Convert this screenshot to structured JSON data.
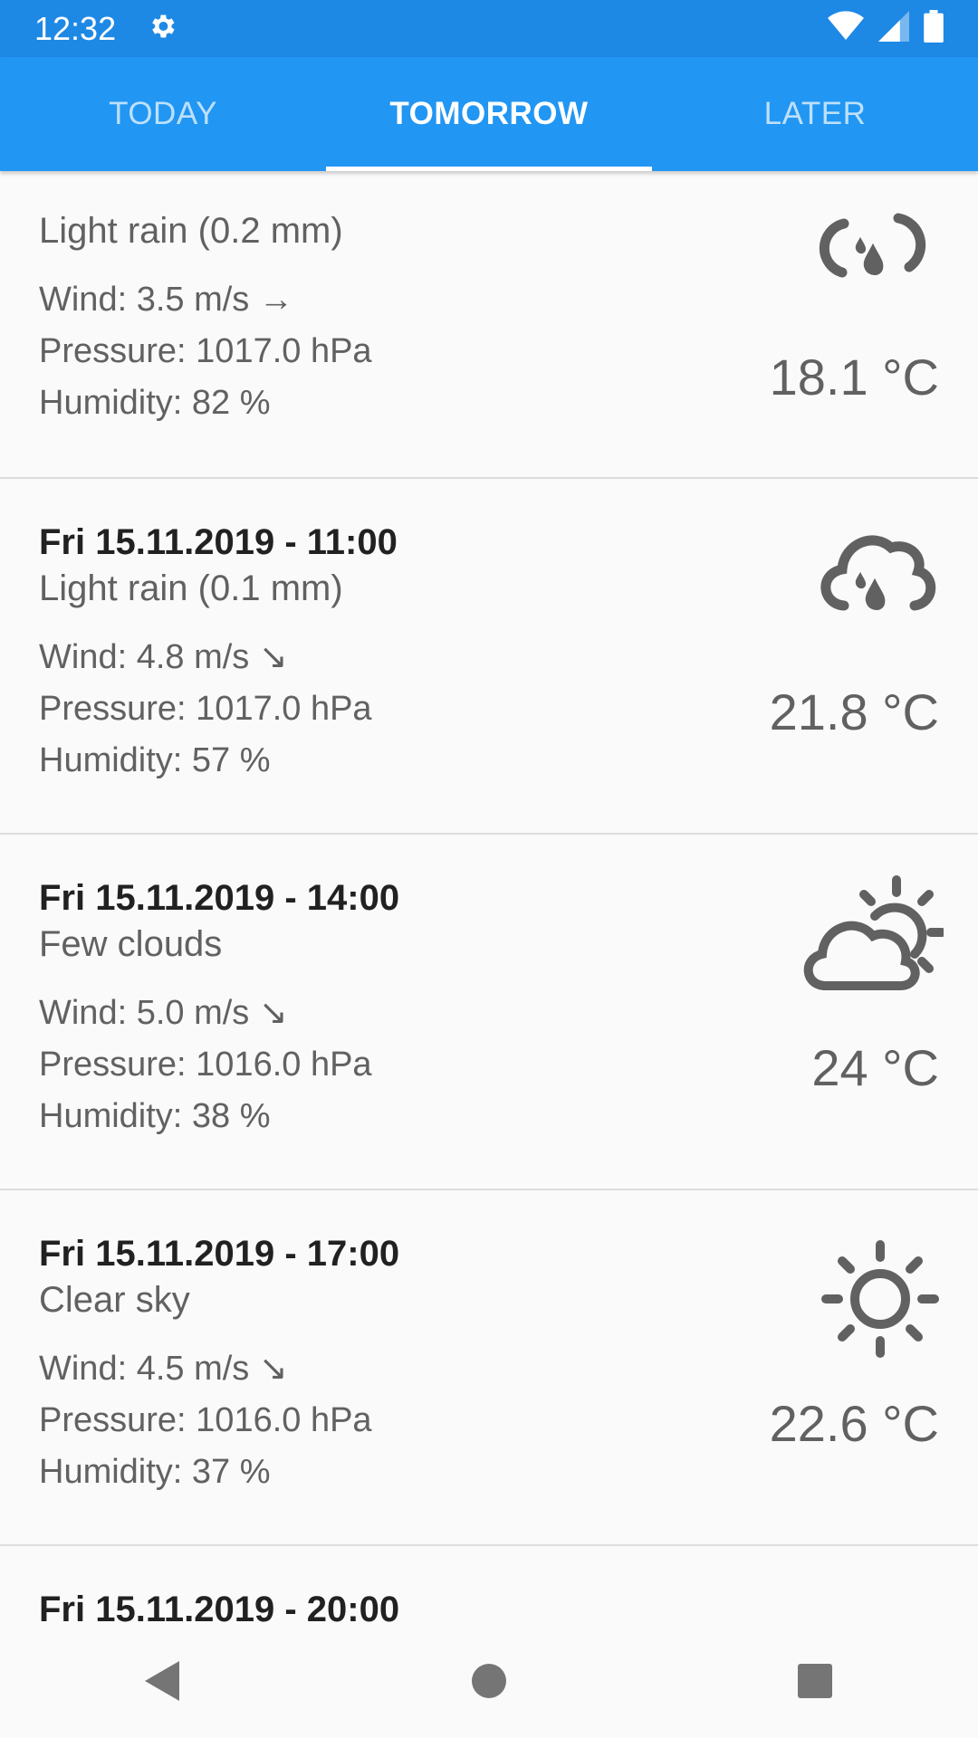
{
  "status": {
    "time": "12:32",
    "icons": [
      "settings-icon",
      "wifi-icon",
      "signal-icon",
      "battery-icon"
    ]
  },
  "tabs": [
    {
      "label": "TODAY",
      "active": false
    },
    {
      "label": "TOMORROW",
      "active": true
    },
    {
      "label": "LATER",
      "active": false
    }
  ],
  "forecasts": [
    {
      "date": "",
      "summary": "Light rain (0.2 mm)",
      "wind": "Wind: 3.5 m/s →",
      "pressure": "Pressure: 1017.0 hPa",
      "humidity": "Humidity: 82 %",
      "temp": "18.1 °C",
      "icon": "light-rain-icon"
    },
    {
      "date": "Fri 15.11.2019 - 11:00",
      "summary": "Light rain (0.1 mm)",
      "wind": "Wind: 4.8 m/s ↘",
      "pressure": "Pressure: 1017.0 hPa",
      "humidity": "Humidity: 57 %",
      "temp": "21.8 °C",
      "icon": "rain-cloud-icon"
    },
    {
      "date": "Fri 15.11.2019 - 14:00",
      "summary": "Few clouds",
      "wind": "Wind: 5.0 m/s ↘",
      "pressure": "Pressure: 1016.0 hPa",
      "humidity": "Humidity: 38 %",
      "temp": "24 °C",
      "icon": "few-clouds-icon"
    },
    {
      "date": "Fri 15.11.2019 - 17:00",
      "summary": "Clear sky",
      "wind": "Wind: 4.5 m/s ↘",
      "pressure": "Pressure: 1016.0 hPa",
      "humidity": "Humidity: 37 %",
      "temp": "22.6 °C",
      "icon": "sun-icon"
    },
    {
      "date": "Fri 15.11.2019 - 20:00",
      "icon": "moon-icon"
    }
  ],
  "colors": {
    "statusbar": "#1e88e5",
    "appbar": "#2196f3",
    "text_primary": "#212121",
    "text_secondary": "#616161"
  },
  "navbar": {
    "icons": [
      "back-icon",
      "home-icon",
      "recents-icon"
    ]
  }
}
